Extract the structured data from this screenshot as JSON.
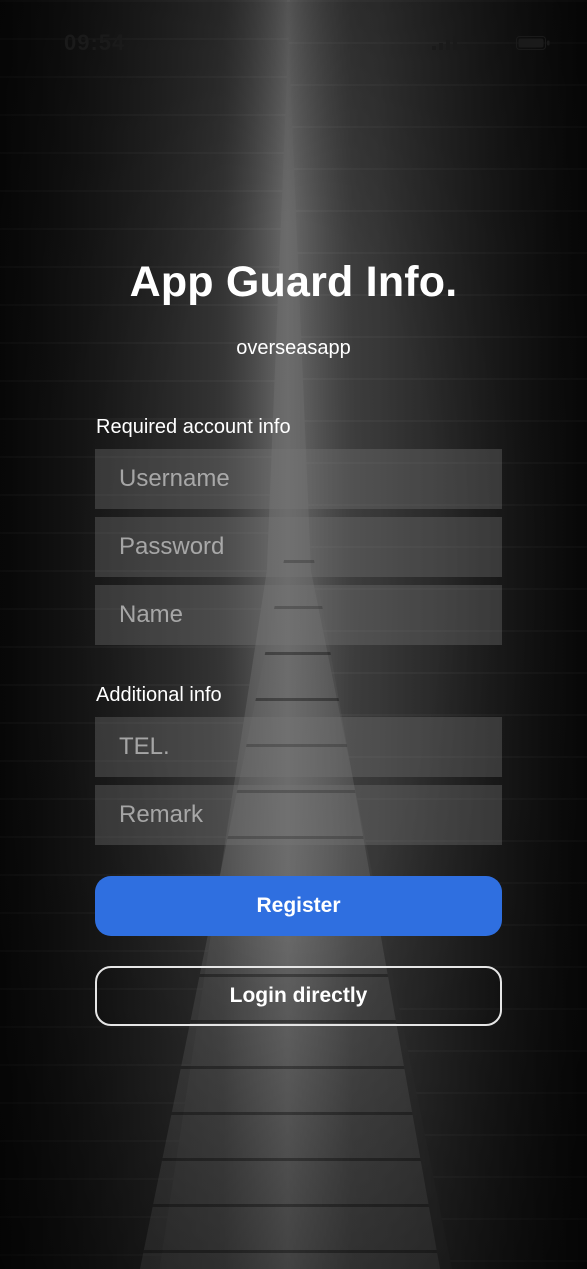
{
  "status_bar": {
    "time": "09:54",
    "signal_icon": "signal-icon",
    "battery_icon": "battery-icon"
  },
  "header": {
    "title": "App Guard Info.",
    "subtitle": "overseasapp"
  },
  "required_section": {
    "label": "Required account info",
    "fields": {
      "username_placeholder": "Username",
      "password_placeholder": "Password",
      "name_placeholder": "Name"
    }
  },
  "additional_section": {
    "label": "Additional info",
    "fields": {
      "tel_placeholder": "TEL.",
      "remark_placeholder": "Remark"
    }
  },
  "actions": {
    "register_label": "Register",
    "login_label": "Login directly"
  },
  "colors": {
    "accent": "#2f6fe0",
    "text": "#ffffff",
    "field_bg": "rgba(120,120,120,0.35)"
  }
}
